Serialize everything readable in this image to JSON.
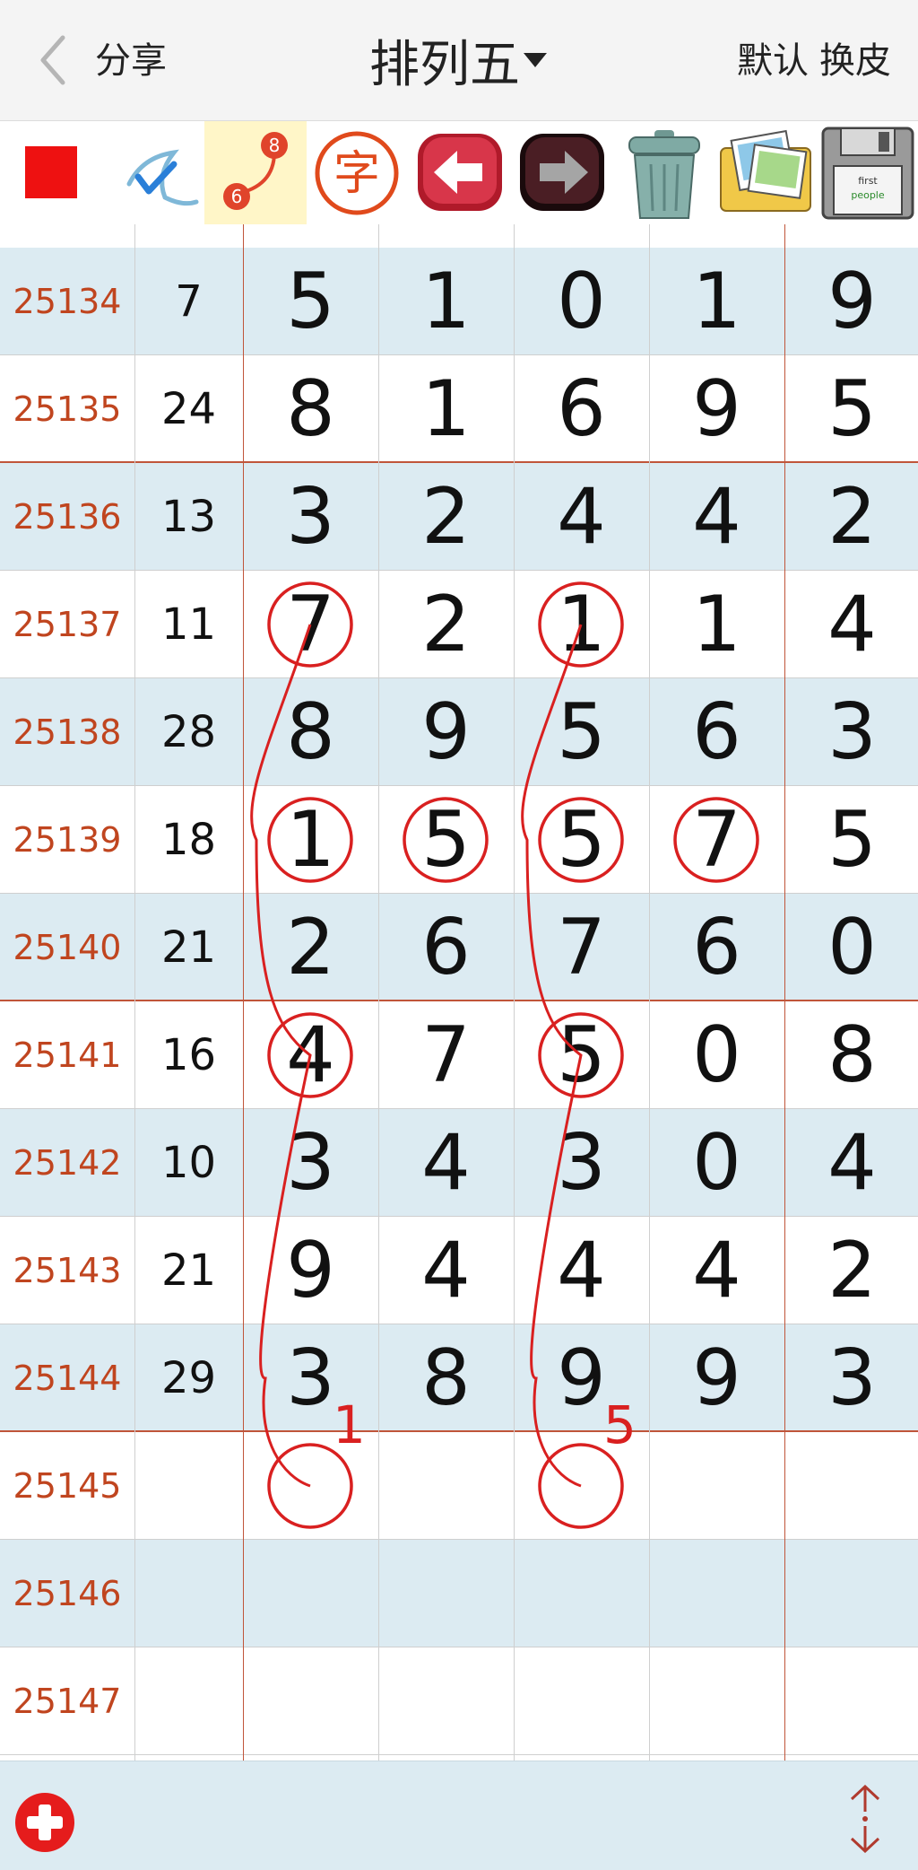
{
  "header": {
    "share_label": "分享",
    "title": "排列五",
    "default_label": "默认",
    "skin_label": "换皮"
  },
  "toolbar": {
    "items": [
      {
        "icon": "red-square-icon",
        "color": "#ee1111"
      },
      {
        "icon": "check-pen-icon"
      },
      {
        "icon": "link-numbers-icon",
        "badge_top": "8",
        "badge_bottom": "6",
        "active": true
      },
      {
        "icon": "text-char-icon",
        "char": "字"
      },
      {
        "icon": "undo-arrow-icon"
      },
      {
        "icon": "redo-arrow-icon"
      },
      {
        "icon": "trash-can-icon"
      },
      {
        "icon": "photo-album-icon"
      },
      {
        "icon": "floppy-save-icon",
        "label_line1": "first",
        "label_line2": "people"
      }
    ]
  },
  "table": {
    "rows": [
      {
        "issue": "25134",
        "sum": "7",
        "digits": [
          "5",
          "1",
          "0",
          "1",
          "9"
        ]
      },
      {
        "issue": "25135",
        "sum": "24",
        "digits": [
          "8",
          "1",
          "6",
          "9",
          "5"
        ]
      },
      {
        "issue": "25136",
        "sum": "13",
        "digits": [
          "3",
          "2",
          "4",
          "4",
          "2"
        ]
      },
      {
        "issue": "25137",
        "sum": "11",
        "digits": [
          "7",
          "2",
          "1",
          "1",
          "4"
        ]
      },
      {
        "issue": "25138",
        "sum": "28",
        "digits": [
          "8",
          "9",
          "5",
          "6",
          "3"
        ]
      },
      {
        "issue": "25139",
        "sum": "18",
        "digits": [
          "1",
          "5",
          "5",
          "7",
          "5"
        ]
      },
      {
        "issue": "25140",
        "sum": "21",
        "digits": [
          "2",
          "6",
          "7",
          "6",
          "0"
        ]
      },
      {
        "issue": "25141",
        "sum": "16",
        "digits": [
          "4",
          "7",
          "5",
          "0",
          "8"
        ]
      },
      {
        "issue": "25142",
        "sum": "10",
        "digits": [
          "3",
          "4",
          "3",
          "0",
          "4"
        ]
      },
      {
        "issue": "25143",
        "sum": "21",
        "digits": [
          "9",
          "4",
          "4",
          "4",
          "2"
        ]
      },
      {
        "issue": "25144",
        "sum": "29",
        "digits": [
          "3",
          "8",
          "9",
          "9",
          "3"
        ]
      },
      {
        "issue": "25145",
        "sum": "",
        "digits": [
          "",
          "",
          "",
          "",
          ""
        ]
      },
      {
        "issue": "25146",
        "sum": "",
        "digits": [
          "",
          "",
          "",
          "",
          ""
        ]
      },
      {
        "issue": "25147",
        "sum": "",
        "digits": [
          "",
          "",
          "",
          "",
          ""
        ]
      }
    ],
    "annotations": {
      "color": "#d92020",
      "circles": [
        {
          "row": 3,
          "col": 0
        },
        {
          "row": 3,
          "col": 2
        },
        {
          "row": 5,
          "col": 0
        },
        {
          "row": 5,
          "col": 1
        },
        {
          "row": 5,
          "col": 2
        },
        {
          "row": 5,
          "col": 3
        },
        {
          "row": 7,
          "col": 0
        },
        {
          "row": 7,
          "col": 2
        },
        {
          "row": 11,
          "col": 0
        },
        {
          "row": 11,
          "col": 2
        }
      ],
      "predictions": [
        {
          "col": 0,
          "text": "1"
        },
        {
          "col": 2,
          "text": "5"
        }
      ]
    }
  },
  "colors": {
    "issue_text": "#c0451f",
    "row_blue": "#dcebf2",
    "separator": "#c0553a",
    "annotation": "#d92020"
  },
  "footer": {
    "add_icon": "add-plus-icon",
    "scroll_icon": "scroll-up-down-icon"
  }
}
